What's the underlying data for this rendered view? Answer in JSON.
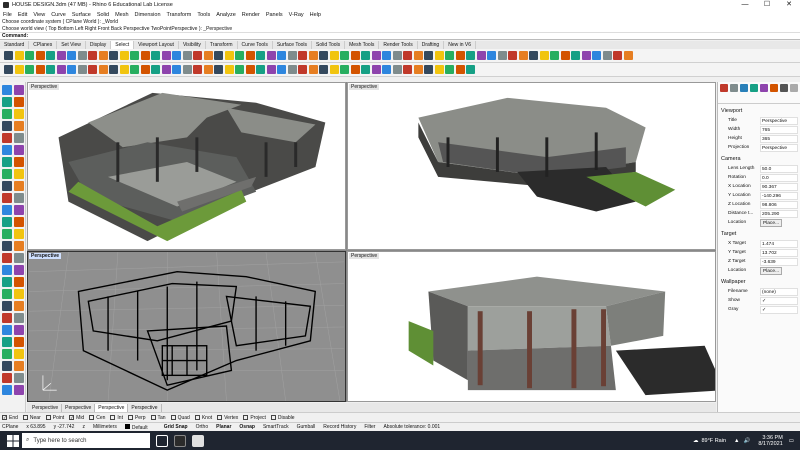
{
  "window": {
    "title": "HOUSE DESIGN.3dm (47 MB) - Rhino 6 Educational Lab License",
    "minimize": "—",
    "maximize": "☐",
    "close": "✕"
  },
  "menu": [
    "File",
    "Edit",
    "View",
    "Curve",
    "Surface",
    "Solid",
    "Mesh",
    "Dimension",
    "Transform",
    "Tools",
    "Analyze",
    "Render",
    "Panels",
    "V-Ray",
    "Help"
  ],
  "command_history": [
    "Choose coordinate system ( CPlane World ): _World",
    "Choose world view ( Top Bottom Left Right Front Back Perspective TwoPointPerspective ): _Perspective"
  ],
  "command_prompt": "Command:",
  "tabs": [
    "Standard",
    "CPlanes",
    "Set View",
    "Display",
    "Select",
    "Viewport Layout",
    "Visibility",
    "Transform",
    "Curve Tools",
    "Surface Tools",
    "Solid Tools",
    "Mesh Tools",
    "Render Tools",
    "Drafting",
    "New in V6"
  ],
  "active_tab": "Select",
  "viewports": [
    {
      "label": "Perspective",
      "active": false
    },
    {
      "label": "Perspective",
      "active": false
    },
    {
      "label": "Perspective",
      "active": true
    },
    {
      "label": "Perspective",
      "active": false
    }
  ],
  "viewport_tabs": [
    "Perspective",
    "Perspective",
    "Perspective",
    "Perspective"
  ],
  "properties": {
    "viewport_header": "Viewport",
    "viewport": [
      {
        "k": "Title",
        "v": "Perspective"
      },
      {
        "k": "Width",
        "v": "765"
      },
      {
        "k": "Height",
        "v": "365"
      },
      {
        "k": "Projection",
        "v": "Perspective"
      }
    ],
    "camera_header": "Camera",
    "camera": [
      {
        "k": "Lens Length",
        "v": "50.0"
      },
      {
        "k": "Rotation",
        "v": "0.0"
      },
      {
        "k": "X Location",
        "v": "90.367"
      },
      {
        "k": "Y Location",
        "v": "-140.296"
      },
      {
        "k": "Z Location",
        "v": "98.806"
      },
      {
        "k": "Distance t...",
        "v": "205.290"
      }
    ],
    "camera_location_label": "Location",
    "place_button": "Place...",
    "target_header": "Target",
    "target": [
      {
        "k": "X Target",
        "v": "1.474"
      },
      {
        "k": "Y Target",
        "v": "13.702"
      },
      {
        "k": "Z Target",
        "v": "-3.639"
      }
    ],
    "target_location_label": "Location",
    "wallpaper_header": "Wallpaper",
    "wallpaper": [
      {
        "k": "Filename",
        "v": "(none)"
      },
      {
        "k": "Show",
        "v": "✓"
      },
      {
        "k": "Gray",
        "v": "✓"
      }
    ]
  },
  "osnap": [
    {
      "label": "End",
      "checked": true
    },
    {
      "label": "Near",
      "checked": false
    },
    {
      "label": "Point",
      "checked": false
    },
    {
      "label": "Mid",
      "checked": true
    },
    {
      "label": "Cen",
      "checked": false
    },
    {
      "label": "Int",
      "checked": false
    },
    {
      "label": "Perp",
      "checked": false
    },
    {
      "label": "Tan",
      "checked": false
    },
    {
      "label": "Quad",
      "checked": false
    },
    {
      "label": "Knot",
      "checked": false
    },
    {
      "label": "Vertex",
      "checked": false
    },
    {
      "label": "Project",
      "checked": false
    },
    {
      "label": "Disable",
      "checked": false
    }
  ],
  "status": {
    "cplane": "CPlane",
    "x": "x 63.895",
    "y": "y -27.742",
    "z": "z",
    "units": "Millimeters",
    "layer": "Default",
    "grid_snap": "Grid Snap",
    "ortho": "Ortho",
    "planar": "Planar",
    "osnap": "Osnap",
    "smarttrack": "SmartTrack",
    "gumball": "Gumball",
    "record_history": "Record History",
    "filter": "Filter",
    "tolerance": "Absolute tolerance: 0.001"
  },
  "taskbar": {
    "search_placeholder": "Type here to search",
    "weather": "89°F  Rain",
    "time": "3:36 PM",
    "date": "8/17/2021"
  },
  "colors": {
    "accent": "#2b6fd6",
    "taskbar": "#1f2530",
    "roof": "#8a8c88",
    "wall_dark": "#3a3a3a",
    "grass": "#6c9a3a"
  }
}
